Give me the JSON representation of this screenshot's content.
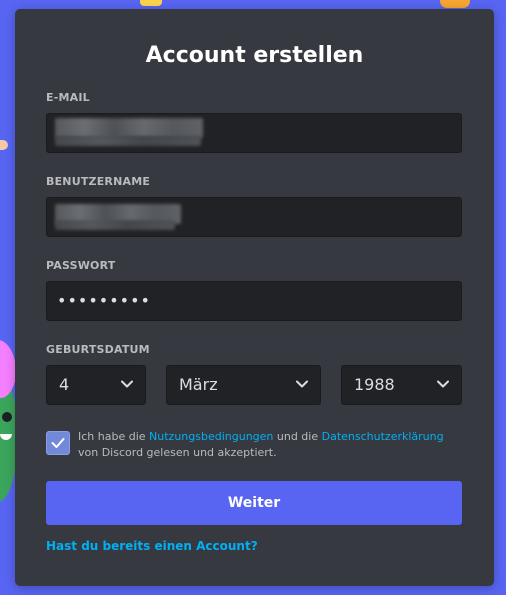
{
  "form": {
    "title": "Account erstellen",
    "email_label": "E-MAIL",
    "email_value": "",
    "username_label": "BENUTZERNAME",
    "username_value": "",
    "password_label": "PASSWORT",
    "password_value": "•••••••••",
    "dob_label": "GEBURTSDATUM",
    "dob": {
      "day": "4",
      "month": "März",
      "year": "1988"
    },
    "consent": {
      "checked": true,
      "text_before": "Ich habe die ",
      "tos_link": "Nutzungsbedingungen",
      "text_middle": " und die ",
      "privacy_link": "Datenschutzerklärung",
      "text_after": " von Discord gelesen und akzeptiert."
    },
    "submit_label": "Weiter",
    "login_link": "Hast du bereits einen Account?"
  },
  "colors": {
    "background": "#5865f2",
    "card": "#36393f",
    "input": "#202225",
    "button": "#5865f2",
    "link": "#00b0f4",
    "checkbox": "#7289da"
  },
  "icons": {
    "dropdown": "chevron-down-icon",
    "checkbox": "checkmark-icon"
  }
}
